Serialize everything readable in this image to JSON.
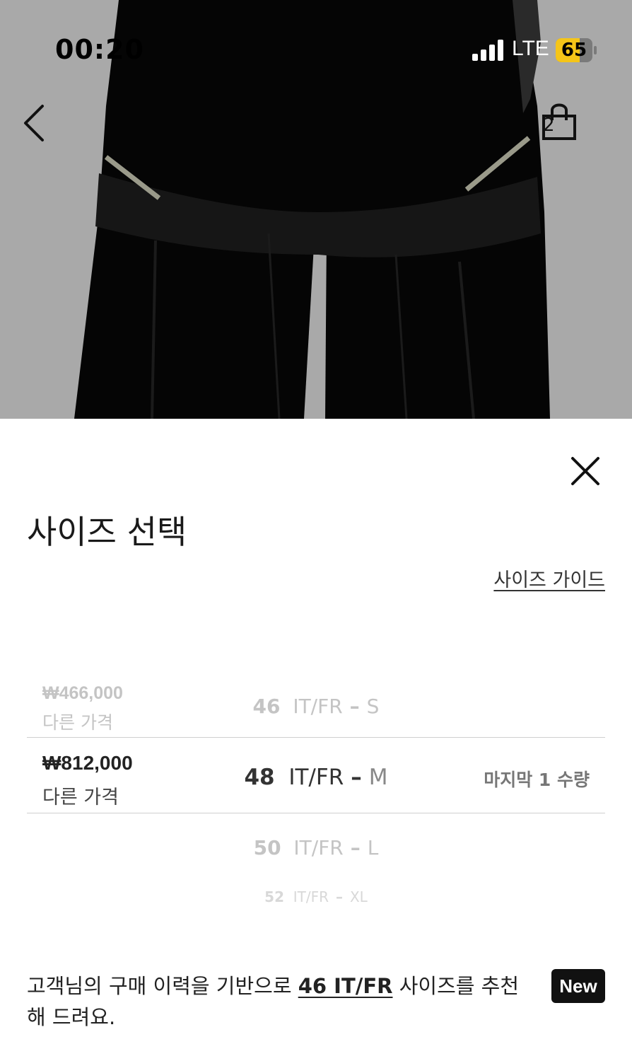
{
  "status_bar": {
    "time": "00:20",
    "network": "LTE",
    "battery_level": "65",
    "battery_percent": 65,
    "battery_color": "#f5c518"
  },
  "nav": {
    "back_icon": "chevron-left-icon",
    "cart_count": "2",
    "cart_icon": "shopping-bag-icon"
  },
  "sheet": {
    "close_icon": "close-icon",
    "title": "사이즈 선택",
    "size_guide": "사이즈 가이드",
    "sizes": [
      {
        "price": "₩466,000",
        "other_price": "다른 가격",
        "size": "46",
        "system": "IT/FR",
        "grade": "S",
        "stock": ""
      },
      {
        "price": "₩812,000",
        "other_price": "다른 가격",
        "size": "48",
        "system": "IT/FR",
        "grade": "M",
        "stock": "마지막 1 수량",
        "selected": true
      },
      {
        "price": "",
        "other_price": "",
        "size": "50",
        "system": "IT/FR",
        "grade": "L",
        "stock": ""
      },
      {
        "price": "",
        "other_price": "",
        "size": "52",
        "system": "IT/FR",
        "grade": "XL",
        "stock": ""
      }
    ],
    "dash": "–",
    "recommendation": {
      "prefix": "고객님의 구매 이력을 기반으로 ",
      "highlight": "46 IT/FR",
      "suffix": " 사이즈를 추천해 드려요.",
      "badge": "New"
    }
  }
}
